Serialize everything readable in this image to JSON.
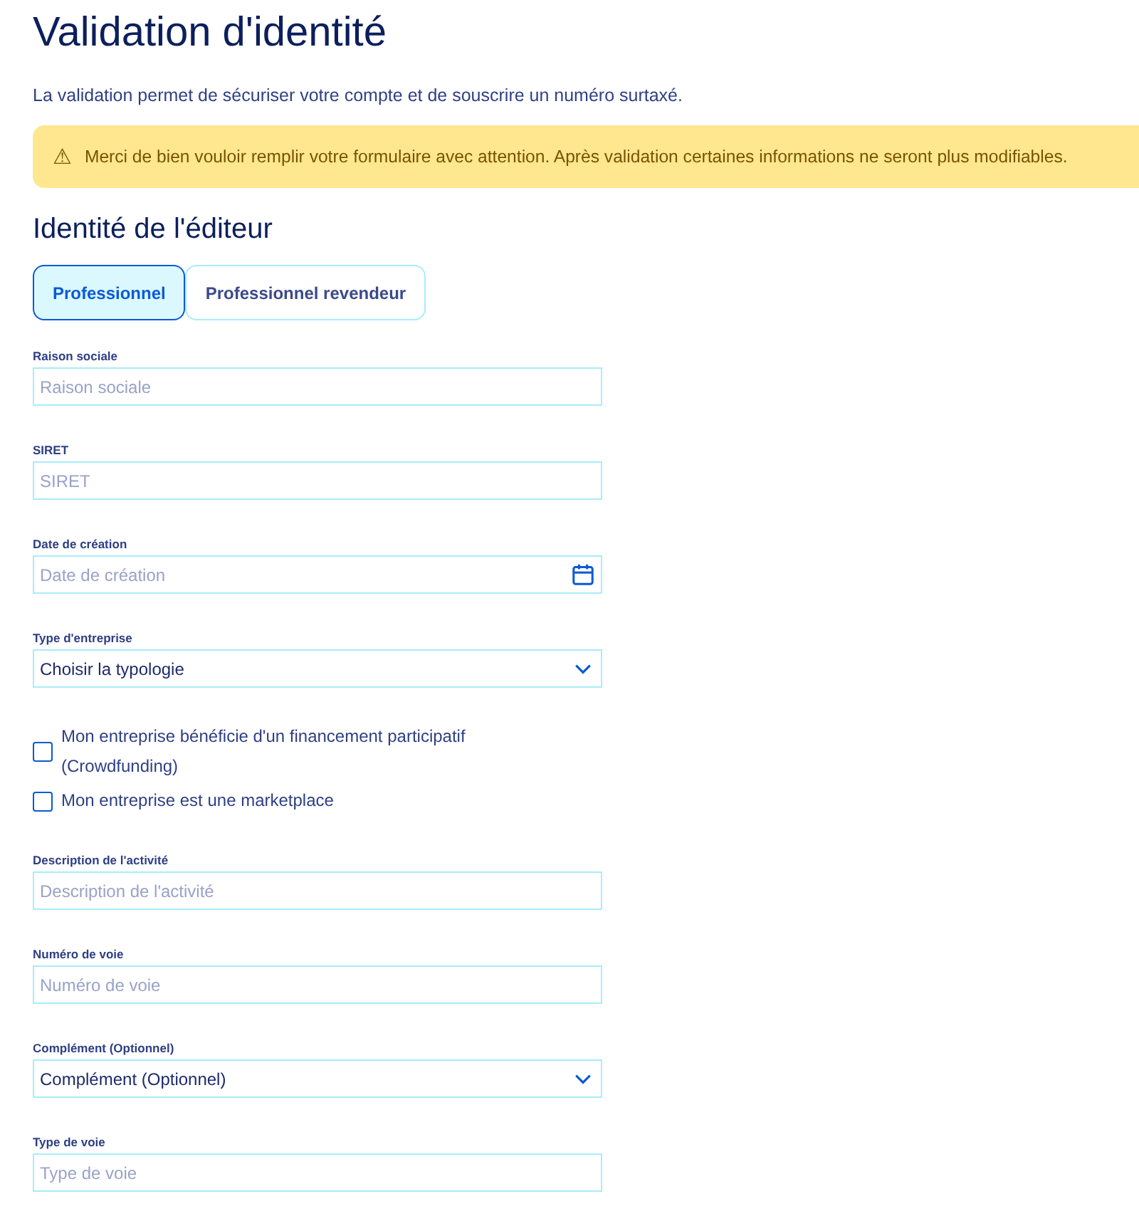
{
  "title": "Validation d'identité",
  "intro": "La validation permet de sécuriser votre compte et de souscrire un numéro surtaxé.",
  "warning": {
    "icon": "⚠",
    "text": "Merci de bien vouloir remplir votre formulaire avec attention. Après validation certaines informations ne seront plus modifiables."
  },
  "section_title": "Identité de l'éditeur",
  "tabs": [
    {
      "label": "Professionnel",
      "selected": true
    },
    {
      "label": "Professionnel revendeur",
      "selected": false
    }
  ],
  "fields": [
    {
      "kind": "text",
      "label": "Raison sociale",
      "placeholder": "Raison sociale"
    },
    {
      "kind": "text",
      "label": "SIRET",
      "placeholder": "SIRET"
    },
    {
      "kind": "date",
      "label": "Date de création",
      "placeholder": "Date de création"
    },
    {
      "kind": "select",
      "label": "Type d'entreprise",
      "value": "Choisir la typologie"
    },
    {
      "kind": "checkbox",
      "label": "Mon entreprise bénéficie d'un financement participatif (Crowdfunding)",
      "checked": false
    },
    {
      "kind": "checkbox",
      "label": "Mon entreprise est une marketplace",
      "checked": false
    },
    {
      "kind": "text",
      "label": "Description de l'activité",
      "placeholder": "Description de l'activité"
    },
    {
      "kind": "text",
      "label": "Numéro de voie",
      "placeholder": "Numéro de voie"
    },
    {
      "kind": "select",
      "label": "Complément (Optionnel)",
      "value": "Complément (Optionnel)"
    },
    {
      "kind": "text",
      "label": "Type de voie",
      "placeholder": "Type de voie"
    }
  ]
}
